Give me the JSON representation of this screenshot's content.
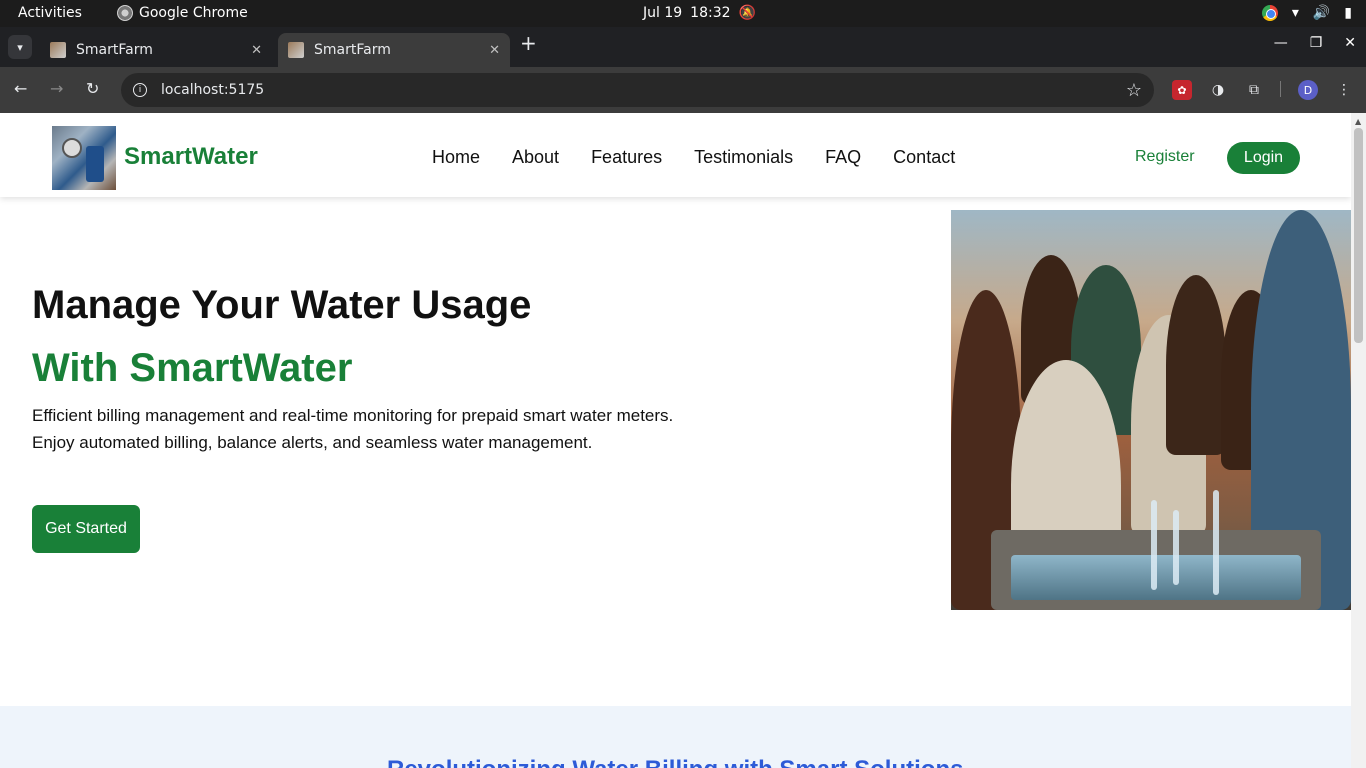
{
  "os_bar": {
    "activities": "Activities",
    "app_name": "Google Chrome",
    "date": "Jul 19",
    "time": "18:32"
  },
  "browser": {
    "tabs": [
      {
        "title": "SmartFarm",
        "active": false
      },
      {
        "title": "SmartFarm",
        "active": true
      }
    ],
    "url": "localhost:5175",
    "profile_initial": "D"
  },
  "site": {
    "brand": "SmartWater",
    "nav": [
      "Home",
      "About",
      "Features",
      "Testimonials",
      "FAQ",
      "Contact"
    ],
    "register": "Register",
    "login": "Login"
  },
  "hero": {
    "title": "Manage Your Water Usage",
    "subtitle": "With SmartWater",
    "desc_line1": "Efficient billing management and real-time monitoring for prepaid smart water meters.",
    "desc_line2": "Enjoy automated billing, balance alerts, and seamless water management.",
    "cta": "Get Started"
  },
  "next_section": {
    "title": "Revolutionizing Water Billing with Smart Solutions"
  },
  "colors": {
    "brand_green": "#198038",
    "section_blue": "#2d5bd7",
    "band_bg": "#eef4fb"
  }
}
